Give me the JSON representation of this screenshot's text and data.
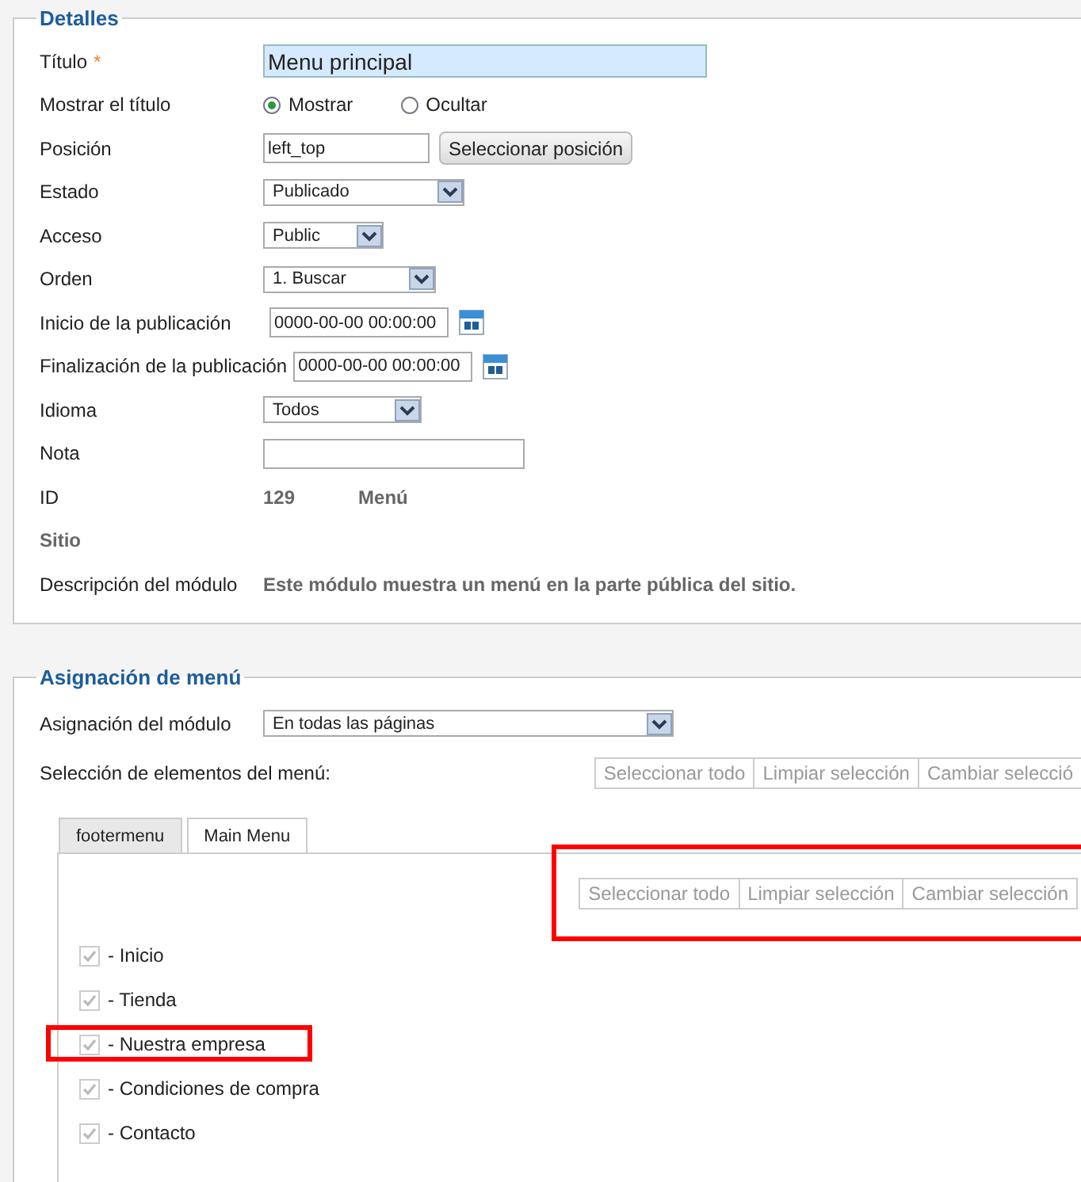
{
  "detalles": {
    "legend": "Detalles",
    "rows": [
      {
        "kind": "input",
        "label": "Título",
        "required_mark": "*",
        "value": "Menu principal",
        "focused": true
      },
      {
        "kind": "radio",
        "label": "Mostrar el título",
        "options": [
          {
            "label": "Mostrar",
            "selected": true
          },
          {
            "label": "Ocultar",
            "selected": false
          }
        ]
      },
      {
        "kind": "input_button",
        "label": "Posición",
        "value": "left_top",
        "button": "Seleccionar posición"
      },
      {
        "kind": "select",
        "label": "Estado",
        "value": "Publicado"
      },
      {
        "kind": "select",
        "label": "Acceso",
        "value": "Public"
      },
      {
        "kind": "select",
        "label": "Orden",
        "value": "1. Buscar"
      },
      {
        "kind": "date",
        "label": "Inicio de la publicación",
        "value": "0000-00-00 00:00:00"
      },
      {
        "kind": "date",
        "label": "Finalización de la publicación",
        "value": "0000-00-00 00:00:00"
      },
      {
        "kind": "select",
        "label": "Idioma",
        "value": "Todos"
      },
      {
        "kind": "input",
        "label": "Nota",
        "focused": false
      },
      {
        "kind": "static",
        "label": "ID",
        "values": [
          "129",
          "Menú"
        ]
      },
      {
        "kind": "caption",
        "label": "Sitio"
      },
      {
        "kind": "static",
        "label": "Descripción del módulo",
        "values": [
          "Este módulo muestra un menú en la parte pública del sitio."
        ]
      }
    ]
  },
  "asignacion": {
    "legend": "Asignación de menú",
    "assignment": {
      "label": "Asignación del módulo",
      "value": "En todas las páginas"
    },
    "selection_label": "Selección de elementos del menú:",
    "buttons": [
      {
        "label": "Seleccionar todo",
        "disabled": true
      },
      {
        "label": "Limpiar selección",
        "disabled": true
      },
      {
        "label": "Cambiar selecció",
        "disabled": true
      }
    ],
    "tabs": [
      {
        "label": "footermenu",
        "selected": false
      },
      {
        "label": "Main Menu",
        "selected": true
      }
    ],
    "tab_buttons": {
      "highlighted": true,
      "buttons": [
        {
          "label": "Seleccionar todo",
          "disabled": true
        },
        {
          "label": "Limpiar selección",
          "disabled": true
        },
        {
          "label": "Cambiar selección",
          "disabled": true
        }
      ]
    },
    "items": [
      {
        "label": "- Inicio",
        "checked": true,
        "disabled": true,
        "highlighted": false
      },
      {
        "label": "- Tienda",
        "checked": true,
        "disabled": true,
        "highlighted": false
      },
      {
        "label": "- Nuestra empresa",
        "checked": true,
        "disabled": true,
        "highlighted": true
      },
      {
        "label": "- Condiciones de compra",
        "checked": true,
        "disabled": true,
        "highlighted": false
      },
      {
        "label": "- Contacto",
        "checked": true,
        "disabled": true,
        "highlighted": false
      }
    ]
  }
}
